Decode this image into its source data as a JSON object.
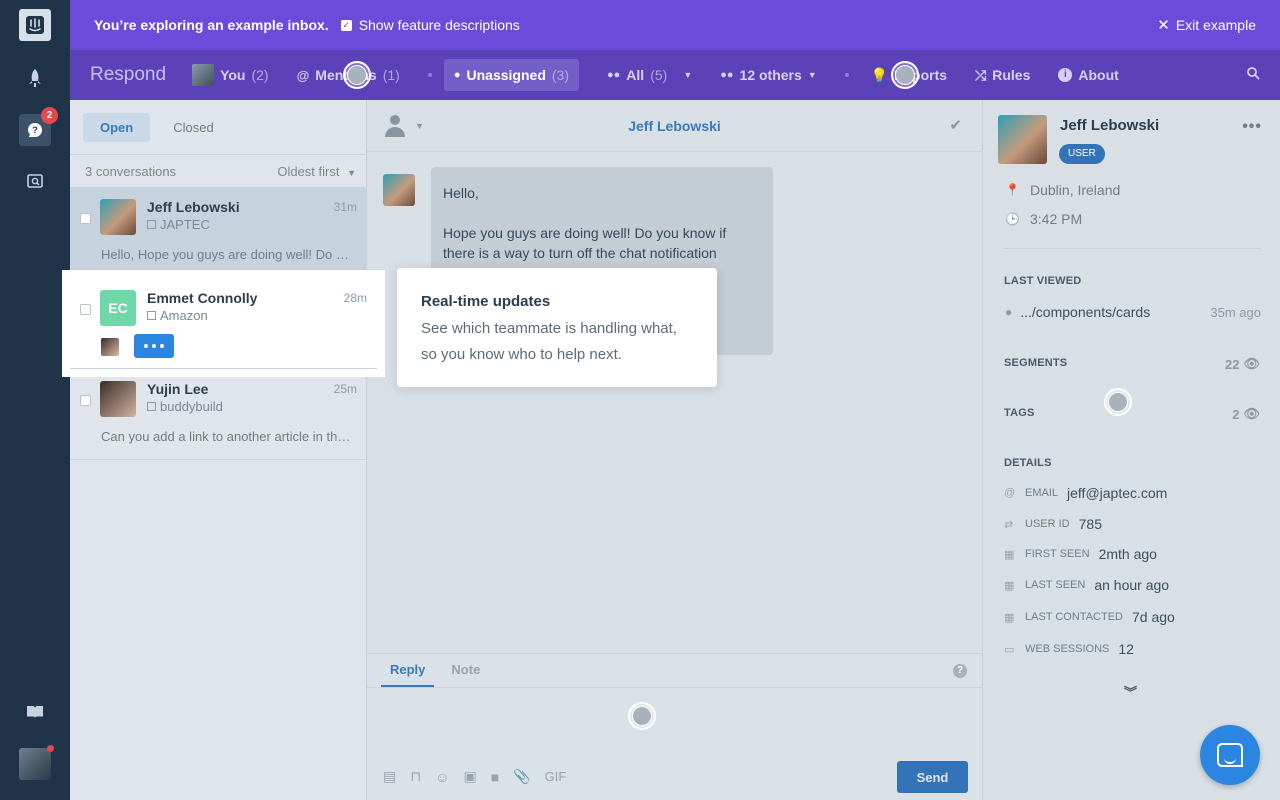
{
  "banner": {
    "title": "You’re exploring an example inbox.",
    "checkbox_label": "Show feature descriptions",
    "exit_label": "Exit example"
  },
  "sidebar": {
    "badge_count": "2"
  },
  "nav": {
    "app_name": "Respond",
    "you": {
      "label": "You",
      "count": "(2)"
    },
    "mentions": {
      "label": "Mentions",
      "count": "(1)"
    },
    "unassigned": {
      "label": "Unassigned",
      "count": "(3)"
    },
    "all": {
      "label": "All",
      "count": "(5)"
    },
    "others": {
      "label": "12 others"
    },
    "reports": {
      "label": "Reports"
    },
    "rules": {
      "label": "Rules"
    },
    "about": {
      "label": "About"
    }
  },
  "list": {
    "tabs": {
      "open": "Open",
      "closed": "Closed"
    },
    "count_label": "3 conversations",
    "sort_label": "Oldest first",
    "conversations": [
      {
        "name": "Jeff Lebowski",
        "company": "JAPTEC",
        "time": "31m",
        "preview": "Hello, Hope you guys are doing well! Do you know if there is a way to turn off the chat notification"
      },
      {
        "name": "Emmet Connolly",
        "initials": "EC",
        "company": "Amazon",
        "time": "28m"
      },
      {
        "name": "Yujin Lee",
        "company": "buddybuild",
        "time": "25m",
        "preview": "Can you add a link to another article in the help center?"
      }
    ]
  },
  "conversation": {
    "title": "Jeff Lebowski",
    "message_line1": "Hello,",
    "message_line2": "Hope you guys are doing well! Do you know if there is a way to turn off the chat notification"
  },
  "composer": {
    "reply_tab": "Reply",
    "note_tab": "Note",
    "help": "?",
    "gif": "GIF",
    "send_label": "Send"
  },
  "tooltip": {
    "title": "Real-time updates",
    "body": "See which teammate is handling what, so you know who to help next."
  },
  "profile": {
    "name": "Jeff Lebowski",
    "badge": "USER",
    "location": "Dublin, Ireland",
    "local_time": "3:42 PM",
    "last_viewed_heading": "LAST VIEWED",
    "last_viewed_page": ".../components/cards",
    "last_viewed_ago": "35m ago",
    "segments_heading": "SEGMENTS",
    "segments_count": "22",
    "tags_heading": "TAGS",
    "tags_count": "2",
    "details_heading": "DETAILS",
    "details": [
      {
        "key": "EMAIL",
        "value": "jeff@japtec.com"
      },
      {
        "key": "USER ID",
        "value": "785"
      },
      {
        "key": "FIRST SEEN",
        "value": "2mth ago"
      },
      {
        "key": "LAST SEEN",
        "value": "an hour ago"
      },
      {
        "key": "LAST CONTACTED",
        "value": "7d ago"
      },
      {
        "key": "WEB SESSIONS",
        "value": "12"
      }
    ]
  }
}
